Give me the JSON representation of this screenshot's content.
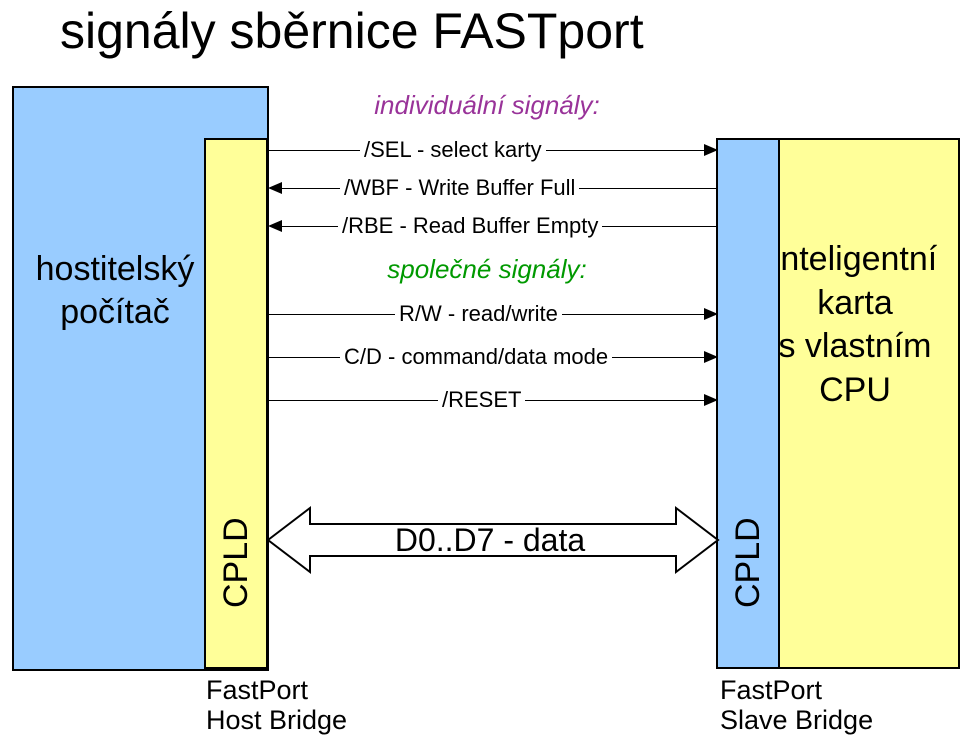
{
  "title": "signály sběrnice FASTport",
  "host": {
    "label_l1": "hostitelský",
    "label_l2": "počítač"
  },
  "card": {
    "label_l1": "inteligentní",
    "label_l2": "karta",
    "label_l3": "s vlastním",
    "label_l4": "CPU"
  },
  "cpld": {
    "host": "CPLD",
    "slave": "CPLD"
  },
  "headings": {
    "individual": "individuální signály:",
    "common": "společné signály:"
  },
  "signals": {
    "sel": "/SEL - select karty",
    "wbf": "/WBF - Write Buffer Full",
    "rbe": "/RBE - Read Buffer Empty",
    "rw": "R/W - read/write",
    "cd": "C/D - command/data mode",
    "reset": "/RESET",
    "data": "D0..D7 - data"
  },
  "bridges": {
    "host_l1": "FastPort",
    "host_l2": "Host Bridge",
    "slave_l1": "FastPort",
    "slave_l2": "Slave Bridge"
  }
}
